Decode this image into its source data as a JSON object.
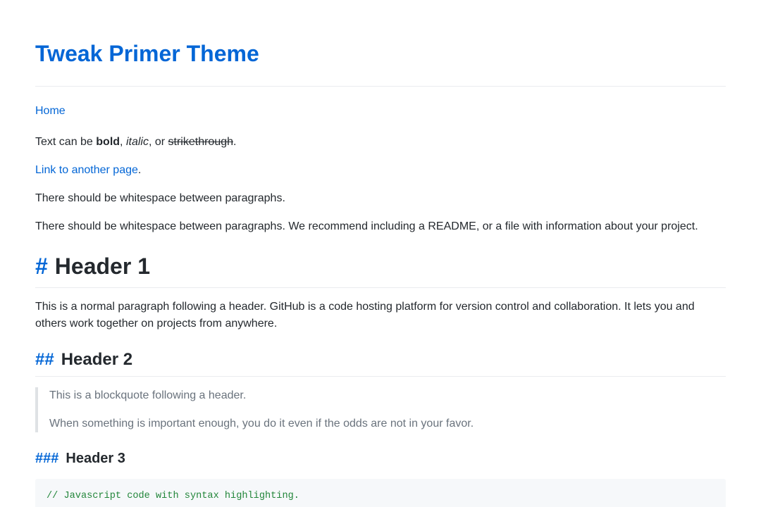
{
  "site": {
    "title": "Tweak Primer Theme"
  },
  "nav": {
    "home": "Home"
  },
  "content": {
    "p1": {
      "prefix": "Text can be ",
      "bold": "bold",
      "comma1": ", ",
      "italic": "italic",
      "comma2": ", or ",
      "strike": "strikethrough",
      "end": "."
    },
    "p2": {
      "link": "Link to another page",
      "end": "."
    },
    "p3": "There should be whitespace between paragraphs.",
    "p4": "There should be whitespace between paragraphs. We recommend including a README, or a file with information about your project.",
    "h1": {
      "hash": "#",
      "text": "Header 1"
    },
    "p5": "This is a normal paragraph following a header. GitHub is a code hosting platform for version control and collaboration. It lets you and others work together on projects from anywhere.",
    "h2": {
      "hash": "##",
      "text": "Header 2"
    },
    "blockquote": [
      "This is a blockquote following a header.",
      "When something is important enough, you do it even if the odds are not in your favor."
    ],
    "h3": {
      "hash": "###",
      "text": "Header 3"
    },
    "code": {
      "line1": "// Javascript code with syntax highlighting."
    }
  },
  "colors": {
    "link": "#0366d6",
    "text": "#24292e",
    "muted": "#6a737d",
    "rule": "#eaecef",
    "code_bg": "#f6f8fa",
    "code_comment": "#22863a"
  }
}
